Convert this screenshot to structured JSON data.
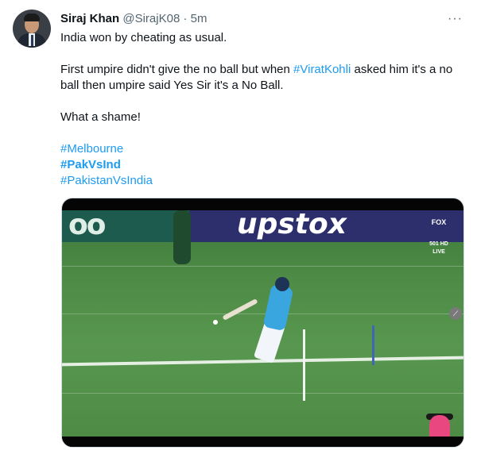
{
  "author": {
    "display_name": "Siraj Khan",
    "handle": "@SirajK08",
    "separator": "·",
    "time": "5m"
  },
  "more_icon": "more-horizontal-icon",
  "tweet": {
    "line1": "India won by cheating as usual.",
    "line2_before": "First umpire didn't give the no ball but when ",
    "line2_hashtag": "#ViratKohli",
    "line2_after": " asked him it's a no ball then umpire said Yes Sir it's a No Ball.",
    "line3": "What a shame!",
    "hashtags": [
      "#Melbourne",
      "#PakVsInd",
      "#PakistanVsIndia"
    ]
  },
  "media": {
    "ad_left_text": "oo",
    "ad_main_text": "upstox",
    "broadcaster": "FOX",
    "broadcaster_sub": "501 HD",
    "live_badge": "LIVE"
  },
  "colors": {
    "link": "#1d9bf0",
    "text": "#0f1419",
    "muted": "#536471"
  }
}
